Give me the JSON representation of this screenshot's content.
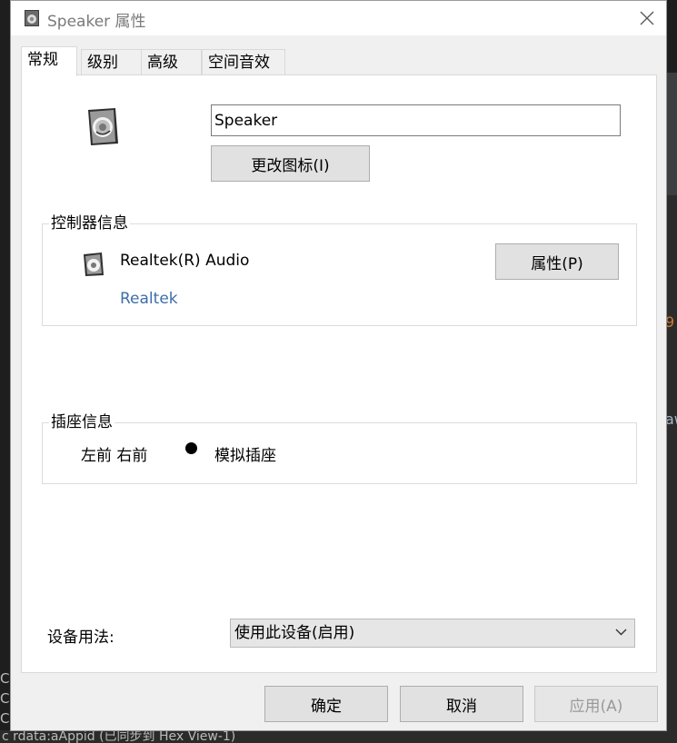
{
  "window": {
    "title": "Speaker 属性",
    "close_icon": "close-icon"
  },
  "tabs": [
    {
      "label": "常规",
      "active": true
    },
    {
      "label": "级别",
      "active": false
    },
    {
      "label": "高级",
      "active": false
    },
    {
      "label": "空间音效",
      "active": false
    }
  ],
  "general": {
    "device_name": "Speaker",
    "change_icon_label": "更改图标(I)"
  },
  "controller": {
    "group_title": "控制器信息",
    "device": "Realtek(R) Audio",
    "vendor_link": "Realtek",
    "properties_label": "属性(P)"
  },
  "jack": {
    "group_title": "插座信息",
    "position": "左前 右前",
    "type": "模拟插座"
  },
  "usage": {
    "label": "设备用法:",
    "selected": "使用此设备(启用)"
  },
  "buttons": {
    "ok": "确定",
    "cancel": "取消",
    "apply": "应用(A)"
  },
  "background": {
    "status_text": "c  rdata:aAppid (已同步到 Hex View-1)",
    "left_chars": [
      "C",
      "C",
      "C"
    ],
    "right_chars": [
      "9",
      "aw"
    ]
  }
}
